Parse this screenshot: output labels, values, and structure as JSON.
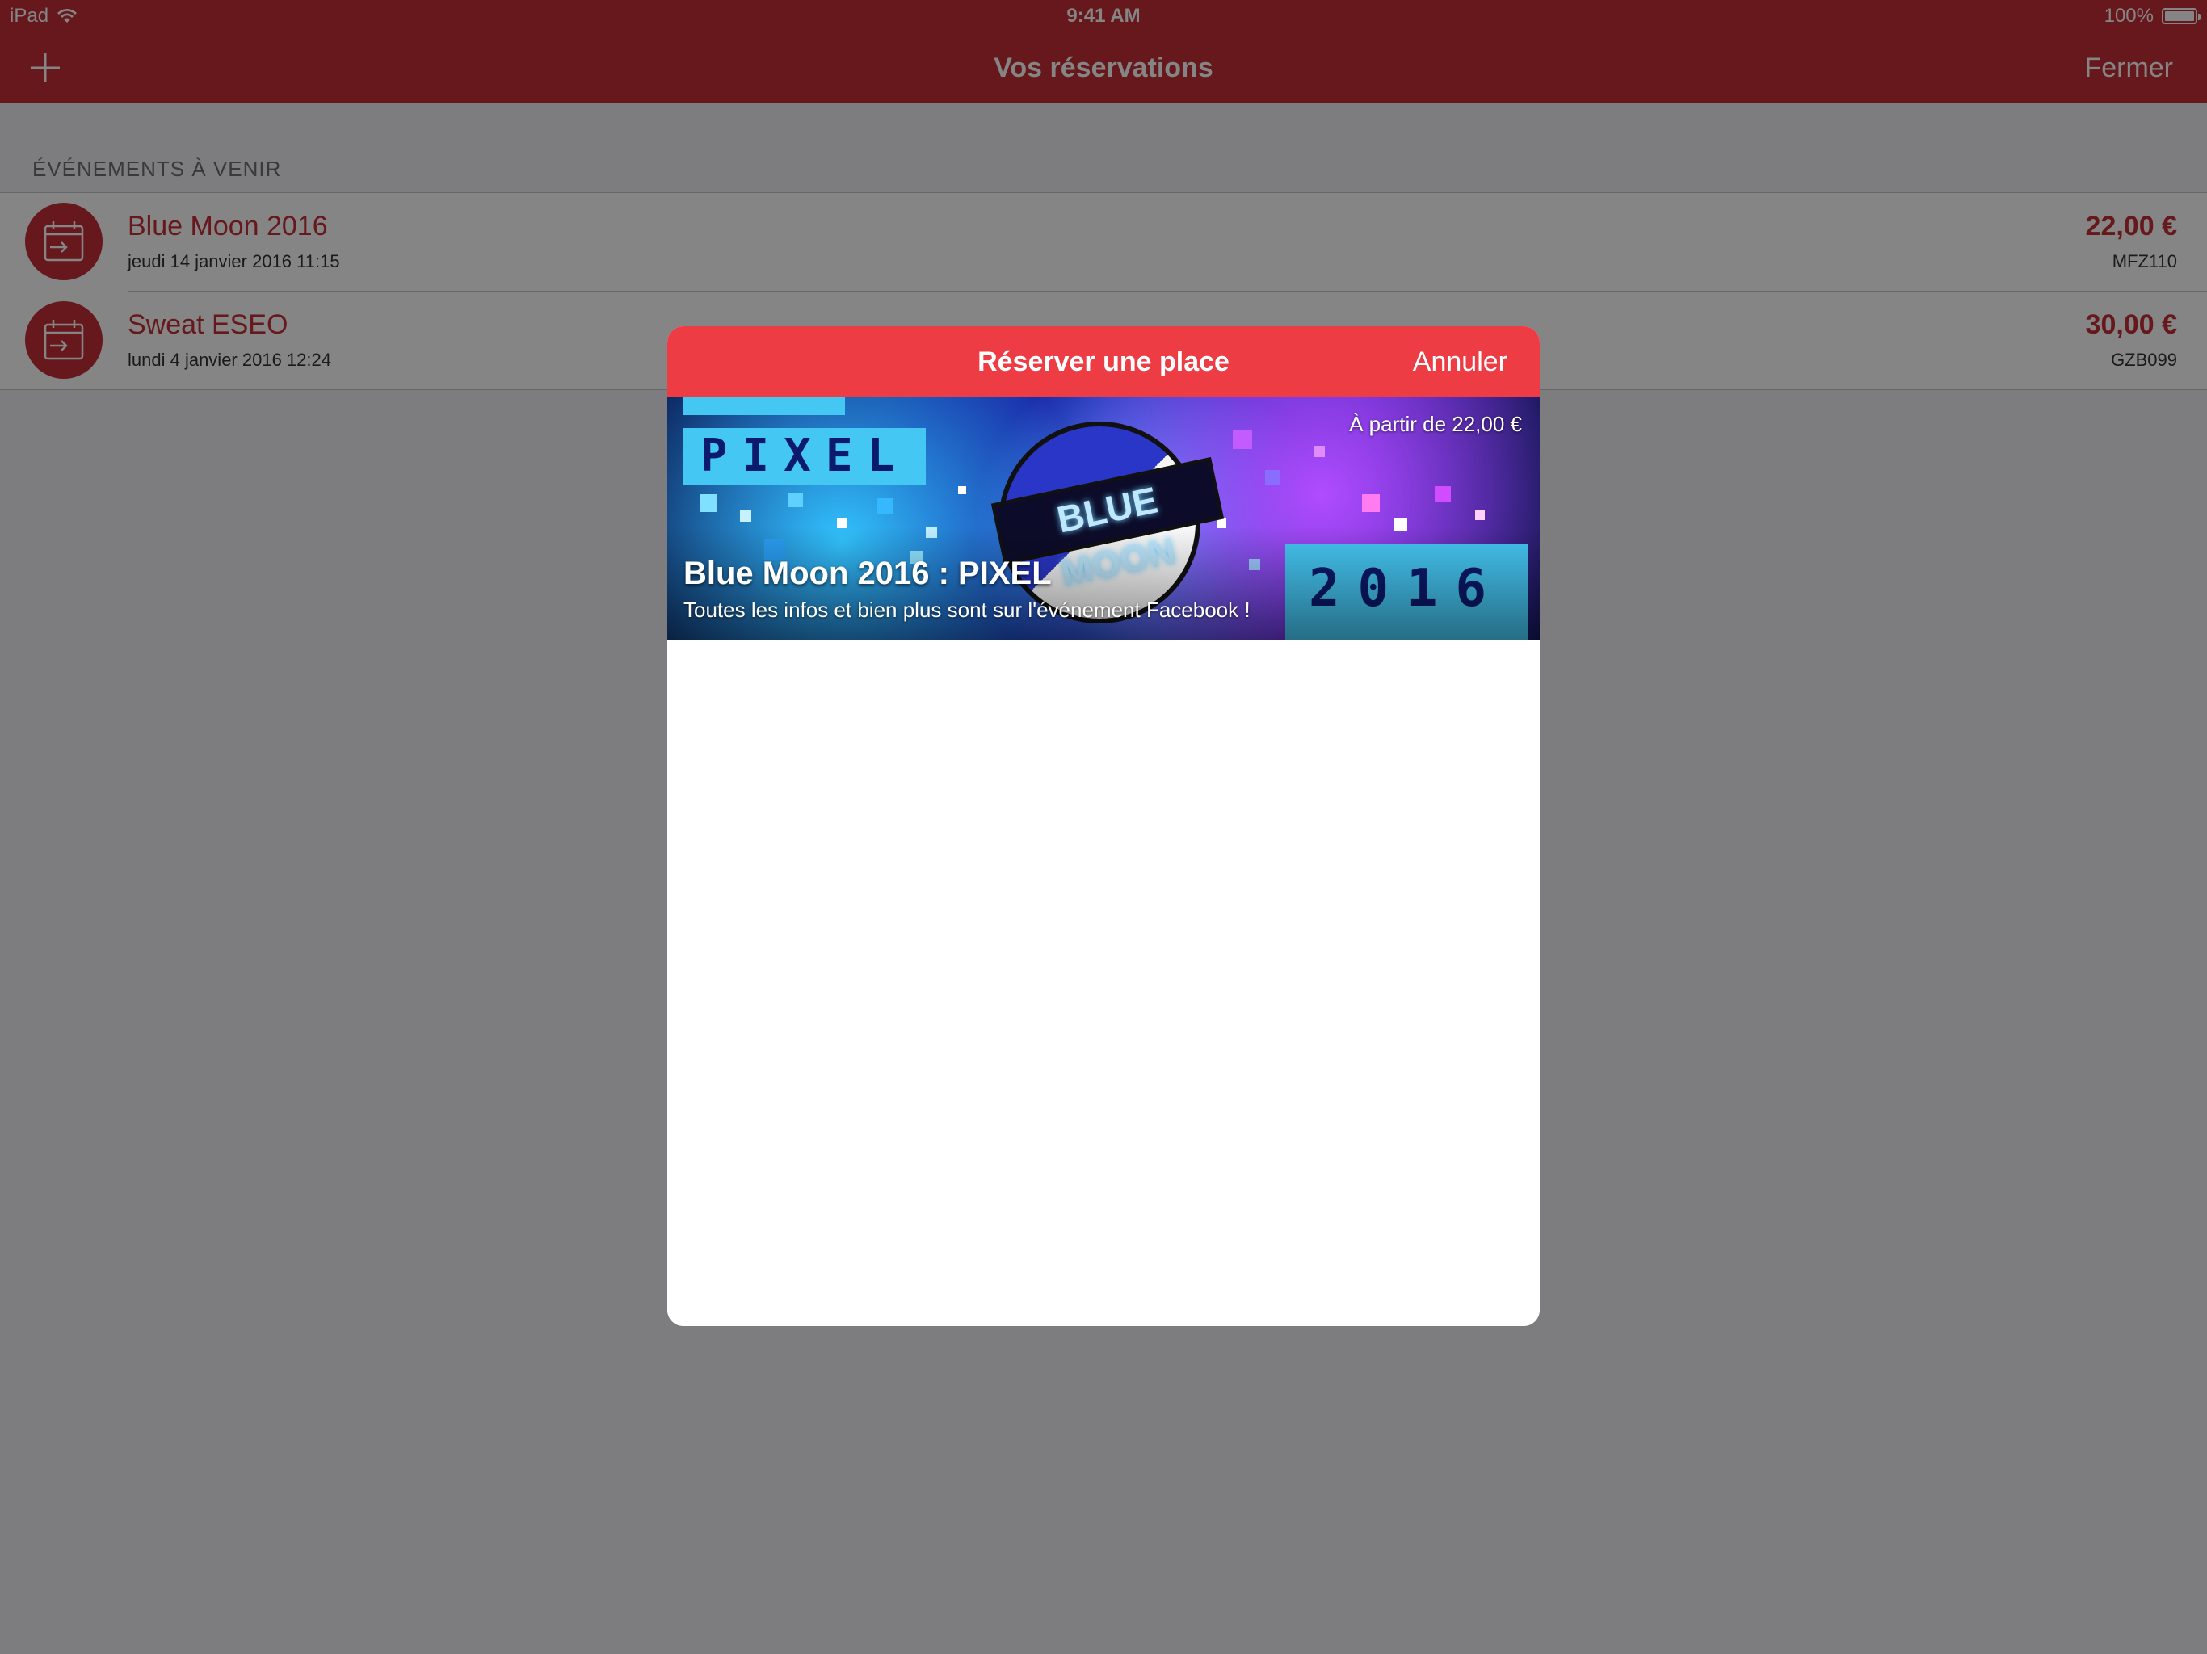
{
  "status_bar": {
    "device": "iPad",
    "time": "9:41 AM",
    "battery": "100%"
  },
  "nav": {
    "title": "Vos réservations",
    "add_icon": "plus-icon",
    "close_label": "Fermer"
  },
  "section": {
    "header": "ÉVÉNEMENTS À VENIR"
  },
  "reservations": [
    {
      "title": "Blue Moon 2016",
      "date": "jeudi 14 janvier 2016 11:15",
      "price": "22,00 €",
      "code": "MFZ110",
      "icon": "calendar-icon"
    },
    {
      "title": "Sweat ESEO",
      "date": "lundi 4 janvier 2016 12:24",
      "price": "30,00 €",
      "code": "GZB099",
      "icon": "calendar-icon"
    }
  ],
  "modal": {
    "title": "Réserver une place",
    "cancel_label": "Annuler",
    "banner": {
      "price": "À partir de 22,00 €",
      "title": "Blue Moon 2016 : PIXEL",
      "subtitle": "Toutes les infos et bien plus sont sur l'événement Facebook !",
      "artwork": {
        "pixel_word": "PIXEL",
        "moon_label": "BLUE MOON",
        "year": "2016"
      }
    }
  },
  "colors": {
    "nav_red": "#c42f37",
    "modal_header_red": "#ee3c45",
    "accent_text": "#c42f37",
    "background": "#efeff4"
  }
}
